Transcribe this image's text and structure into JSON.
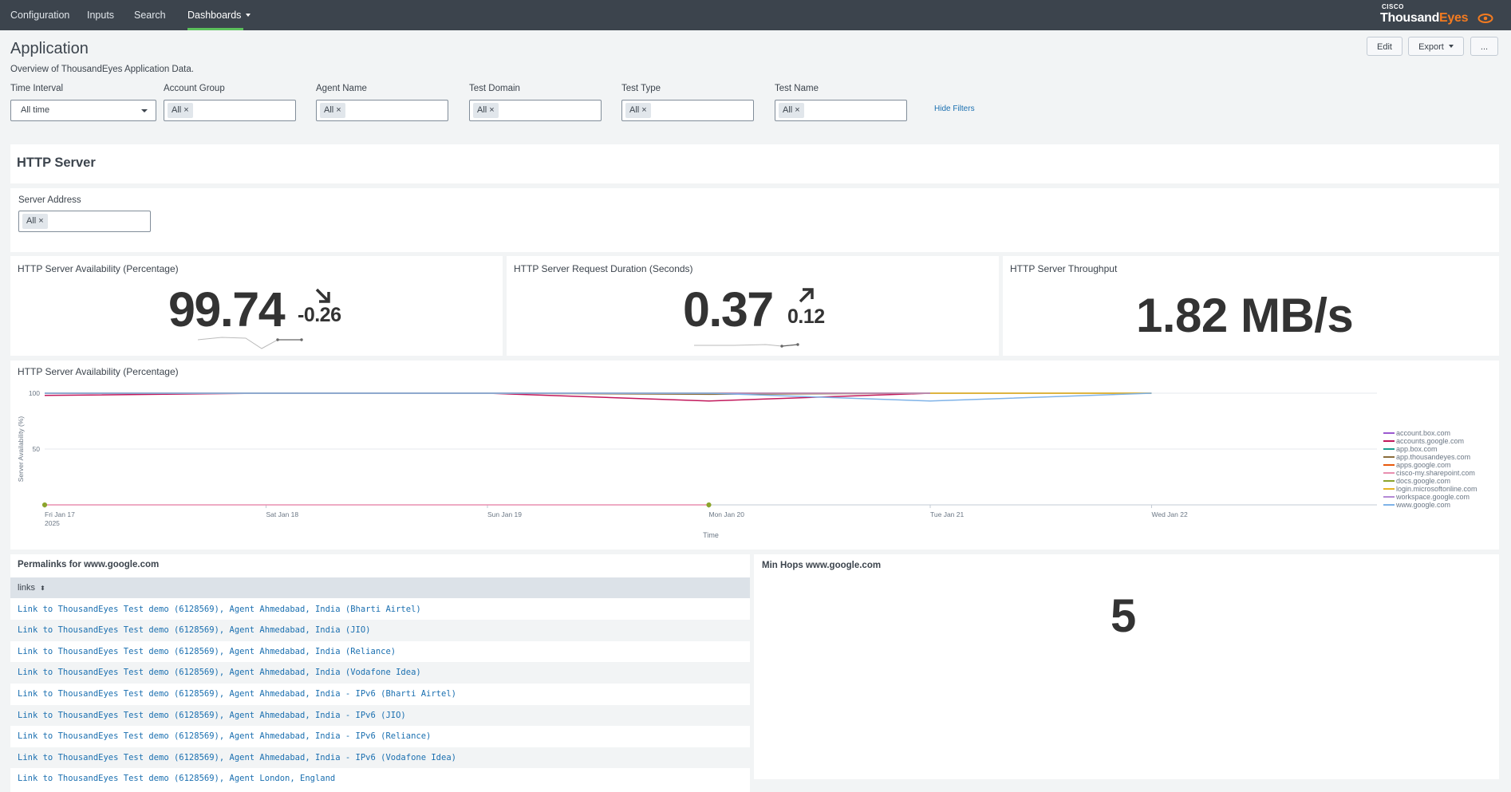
{
  "nav": {
    "items": [
      "Configuration",
      "Inputs",
      "Search",
      "Dashboards"
    ],
    "brand_cisco": "CISCO",
    "brand_name_a": "Thousand",
    "brand_name_b": "Eyes"
  },
  "header": {
    "title": "Application",
    "description": "Overview of ThousandEyes Application Data.",
    "edit": "Edit",
    "export": "Export",
    "more": "..."
  },
  "filters": {
    "time_interval": {
      "label": "Time Interval",
      "value": "All time"
    },
    "account_group": {
      "label": "Account Group",
      "value": "All"
    },
    "agent_name": {
      "label": "Agent Name",
      "value": "All"
    },
    "test_domain": {
      "label": "Test Domain",
      "value": "All"
    },
    "test_type": {
      "label": "Test Type",
      "value": "All"
    },
    "test_name": {
      "label": "Test Name",
      "value": "All"
    },
    "hide": "Hide Filters"
  },
  "section": {
    "title": "HTTP Server",
    "server_address_label": "Server Address",
    "server_address_value": "All"
  },
  "kpis": [
    {
      "title": "HTTP Server Availability (Percentage)",
      "value": "99.74",
      "delta": "-0.26",
      "direction": "down"
    },
    {
      "title": "HTTP Server Request Duration (Seconds)",
      "value": "0.37",
      "delta": "0.12",
      "direction": "up"
    },
    {
      "title": "HTTP Server Throughput",
      "value": "1.82 MB/s"
    }
  ],
  "chart_data": {
    "type": "line",
    "title": "HTTP Server Availability (Percentage)",
    "xlabel": "Time",
    "ylabel": "Server Availability (%)",
    "yticks": [
      "100",
      "50"
    ],
    "ylim": [
      0,
      100
    ],
    "x": [
      "Fri Jan 17",
      "Sat Jan 18",
      "Sun Jan 19",
      "Mon Jan 20",
      "Tue Jan 21",
      "Wed Jan 22"
    ],
    "x_year": "2025",
    "series": [
      {
        "name": "account.box.com",
        "color": "#9b59d0",
        "values": [
          100,
          100,
          100,
          100,
          100,
          null
        ]
      },
      {
        "name": "accounts.google.com",
        "color": "#c2185b",
        "values": [
          98,
          100,
          100,
          93,
          100,
          null
        ]
      },
      {
        "name": "app.box.com",
        "color": "#1a9e8f",
        "values": [
          100,
          100,
          100,
          100,
          100,
          null
        ]
      },
      {
        "name": "app.thousandeyes.com",
        "color": "#8a6d3b",
        "values": [
          100,
          100,
          100,
          99,
          100,
          100
        ]
      },
      {
        "name": "apps.google.com",
        "color": "#e8590c",
        "values": [
          100,
          100,
          100,
          100,
          100,
          null
        ]
      },
      {
        "name": "cisco-my.sharepoint.com",
        "color": "#e88fb0",
        "values": [
          0,
          0,
          0,
          0,
          null,
          null
        ]
      },
      {
        "name": "docs.google.com",
        "color": "#8ca42c",
        "values": [
          0,
          null,
          null,
          0,
          null,
          null
        ]
      },
      {
        "name": "login.microsoftonline.com",
        "color": "#e6b422",
        "values": [
          100,
          100,
          100,
          100,
          100,
          100
        ]
      },
      {
        "name": "workspace.google.com",
        "color": "#b48ad6",
        "values": [
          100,
          100,
          100,
          100,
          100,
          null
        ]
      },
      {
        "name": "www.google.com",
        "color": "#7fb3e8",
        "values": [
          100,
          100,
          100,
          100,
          93,
          100
        ]
      }
    ]
  },
  "permalinks": {
    "title": "Permalinks for www.google.com",
    "column": "links",
    "rows": [
      "Link to ThousandEyes Test demo (6128569), Agent Ahmedabad, India (Bharti Airtel)",
      "Link to ThousandEyes Test demo (6128569), Agent Ahmedabad, India (JIO)",
      "Link to ThousandEyes Test demo (6128569), Agent Ahmedabad, India (Reliance)",
      "Link to ThousandEyes Test demo (6128569), Agent Ahmedabad, India (Vodafone Idea)",
      "Link to ThousandEyes Test demo (6128569), Agent Ahmedabad, India - IPv6 (Bharti Airtel)",
      "Link to ThousandEyes Test demo (6128569), Agent Ahmedabad, India - IPv6 (JIO)",
      "Link to ThousandEyes Test demo (6128569), Agent Ahmedabad, India - IPv6 (Reliance)",
      "Link to ThousandEyes Test demo (6128569), Agent Ahmedabad, India - IPv6 (Vodafone Idea)",
      "Link to ThousandEyes Test demo (6128569), Agent London, England"
    ]
  },
  "min_hops": {
    "title": "Min Hops www.google.com",
    "value": "5"
  }
}
